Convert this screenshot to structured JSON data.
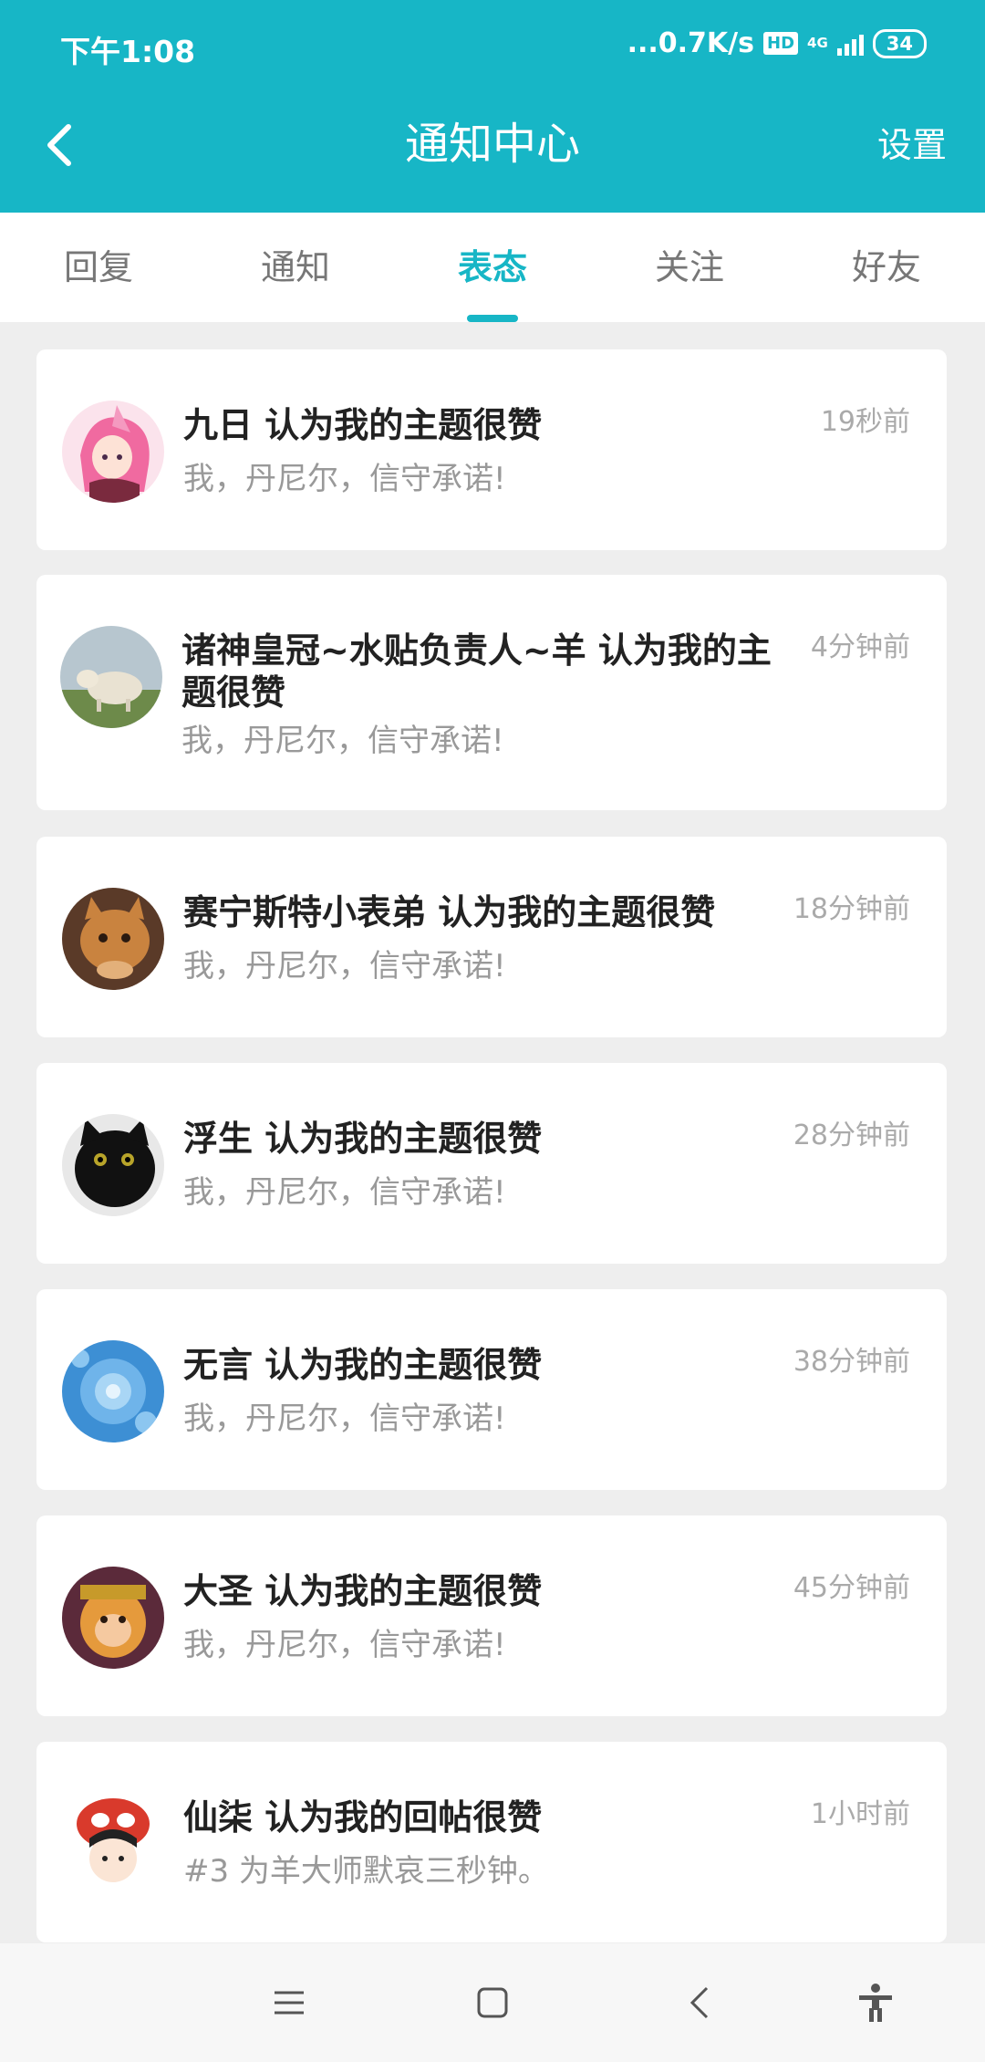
{
  "status_bar": {
    "time": "下午1:08",
    "network_speed": "...0.7K/s",
    "hd_badge": "HD",
    "network_type": "4G",
    "battery": "34"
  },
  "header": {
    "title": "通知中心",
    "settings_label": "设置"
  },
  "tabs": [
    {
      "label": "回复",
      "active": false
    },
    {
      "label": "通知",
      "active": false
    },
    {
      "label": "表态",
      "active": true
    },
    {
      "label": "关注",
      "active": false
    },
    {
      "label": "好友",
      "active": false
    }
  ],
  "notifications": [
    {
      "title": "九日 认为我的主题很赞",
      "subtitle": "我，丹尼尔，信守承诺!",
      "time": "19秒前",
      "avatar_icon": "anime-girl-avatar"
    },
    {
      "title": "诸神皇冠~水贴负责人~羊 认为我的主",
      "title_line2": "题很赞",
      "subtitle": "我，丹尼尔，信守承诺!",
      "time": "4分钟前",
      "avatar_icon": "sheep-avatar"
    },
    {
      "title": "赛宁斯特小表弟 认为我的主题很赞",
      "subtitle": "我，丹尼尔，信守承诺!",
      "time": "18分钟前",
      "avatar_icon": "cat-avatar"
    },
    {
      "title": "浮生 认为我的主题很赞",
      "subtitle": "我，丹尼尔，信守承诺!",
      "time": "28分钟前",
      "avatar_icon": "black-cat-avatar"
    },
    {
      "title": "无言 认为我的主题很赞",
      "subtitle": "我，丹尼尔，信守承诺!",
      "time": "38分钟前",
      "avatar_icon": "blue-flower-avatar"
    },
    {
      "title": "大圣 认为我的主题很赞",
      "subtitle": "我，丹尼尔，信守承诺!",
      "time": "45分钟前",
      "avatar_icon": "monkey-king-avatar"
    },
    {
      "title": "仙柒 认为我的回帖很赞",
      "subtitle": "#3 为羊大师默哀三秒钟。",
      "time": "1小时前",
      "avatar_icon": "cartoon-avatar"
    }
  ],
  "colors": {
    "accent": "#17b6c6",
    "background": "#eeeeee",
    "card": "#ffffff"
  }
}
